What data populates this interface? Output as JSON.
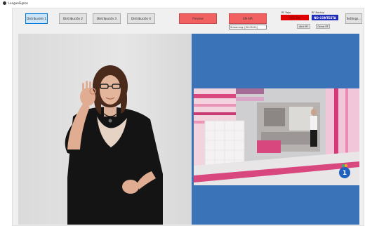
{
  "titlebar": {
    "title": "LenguaSignos"
  },
  "toolbar": {
    "distribution_buttons": [
      {
        "label": "Distribución 1",
        "active": true
      },
      {
        "label": "Distribución 2",
        "active": false
      },
      {
        "label": "Distribución 3",
        "active": false
      },
      {
        "label": "Distribución 4",
        "active": false
      }
    ],
    "preview_label": "Preview",
    "onair_label": "EN AIR",
    "streaming_value": "Streaming: [00:00:00]",
    "rec_label": "RF Rojo",
    "rec_status": "REC OK",
    "backup_label": "RF Backup",
    "backup_status": "NO CONTESTA",
    "open_rf_label": "Abrir RF",
    "close_rf_label": "Cerrar RF",
    "settings_label": "Settings..."
  },
  "colors": {
    "window_bg": "#f0f0f0",
    "video_bg": "#3a73b8",
    "alert_red": "#f26161",
    "rec_red": "#e00000",
    "status_blue": "#1e2ab8"
  },
  "icons": {
    "channel_logo": "tve1-logo-icon"
  }
}
